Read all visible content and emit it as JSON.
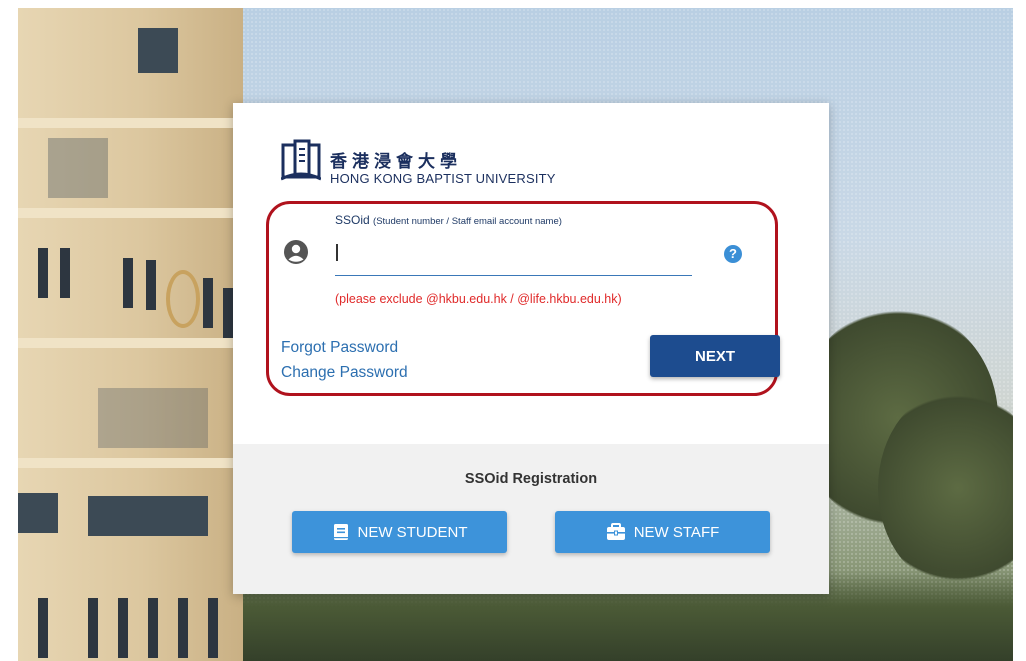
{
  "branding": {
    "name_cn": "香港浸會大學",
    "name_en": "HONG KONG BAPTIST UNIVERSITY"
  },
  "login": {
    "field_label": "SSOid",
    "field_label_sub": "(Student number / Staff email account name)",
    "input_value": "",
    "help_icon": "?",
    "hint": "(please exclude @hkbu.edu.hk / @life.hkbu.edu.hk)",
    "forgot_password": "Forgot Password",
    "change_password": "Change Password",
    "next_label": "NEXT"
  },
  "registration": {
    "title": "SSOid Registration",
    "new_student_label": "NEW STUDENT",
    "new_staff_label": "NEW STAFF"
  },
  "colors": {
    "brand_navy": "#1b2f5e",
    "next_button": "#1d4c8f",
    "register_button": "#3d93da",
    "hint_red": "#e02a2a",
    "highlight_border": "#b0121d"
  },
  "icons": [
    "user-icon",
    "help-icon",
    "book-icon",
    "briefcase-icon",
    "university-logo"
  ]
}
